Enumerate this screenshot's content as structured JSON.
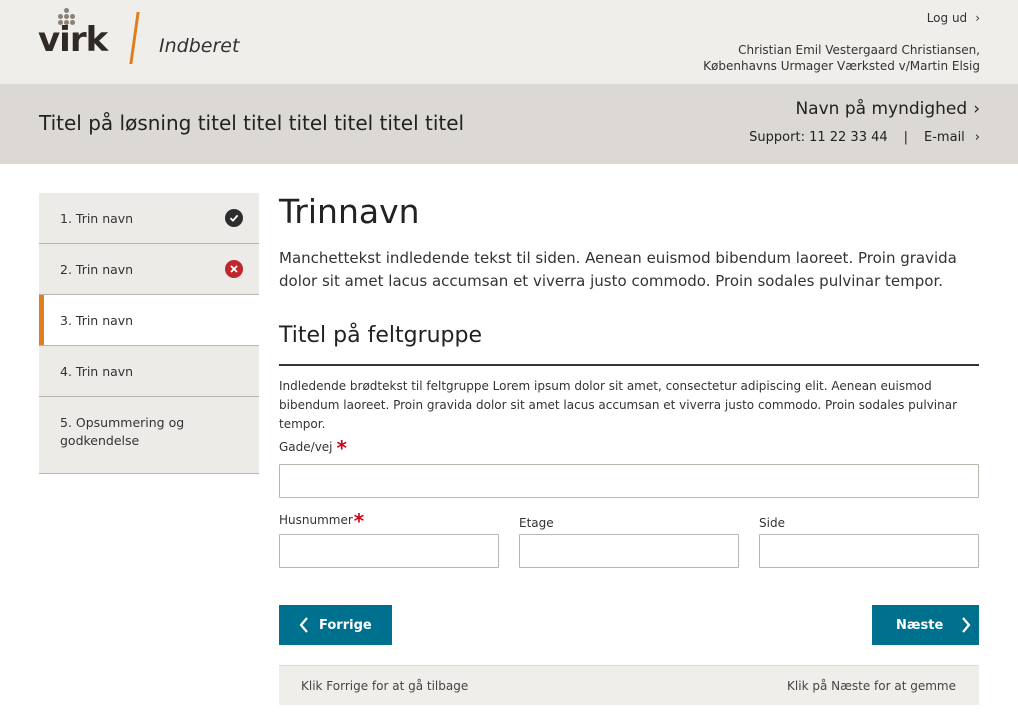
{
  "header": {
    "logo_text": "virk",
    "app_name": "Indberet",
    "logout_label": "Log ud",
    "user_name": "Christian Emil Vestergaard Christiansen,",
    "company": "Københavns Urmager Værksted v/Martin Elsig"
  },
  "titleband": {
    "solution_title": "Titel på løsning titel titel titel titel titel titel",
    "authority_label": "Navn på myndighed",
    "support_label": "Support: 11 22 33 44",
    "separator": "|",
    "email_label": "E-mail"
  },
  "steps": [
    {
      "label": "1. Trin navn",
      "status": "done"
    },
    {
      "label": "2. Trin navn",
      "status": "error"
    },
    {
      "label": "3. Trin navn",
      "status": "current"
    },
    {
      "label": "4. Trin navn",
      "status": ""
    },
    {
      "label": "5. Opsummering og godkendelse",
      "status": ""
    }
  ],
  "main": {
    "title": "Trinnavn",
    "lead": "Manchettekst indledende tekst til siden. Aenean euismod bibendum laoreet. Proin gravida dolor sit amet lacus accumsan et viverra justo commodo. Proin sodales pulvinar tempor.",
    "group_title": "Titel på feltgruppe",
    "group_intro": "Indledende brødtekst til feltgruppe Lorem ipsum dolor sit amet, consectetur adipiscing elit. Aenean euismod bibendum laoreet. Proin gravida dolor sit amet lacus accumsan et viverra justo commodo. Proin sodales pulvinar tempor.",
    "fields": {
      "street_label": "Gade/vej",
      "street_value": "",
      "house_label": "Husnummer",
      "house_value": "",
      "floor_label": "Etage",
      "floor_value": "",
      "side_label": "Side",
      "side_value": "",
      "required_mark": "*"
    }
  },
  "nav": {
    "prev_label": "Forrige",
    "next_label": "Næste",
    "prev_hint": "Klik Forrige for at gå tilbage",
    "next_hint": "Klik på Næste for at gemme"
  },
  "colors": {
    "accent_orange": "#e07e1f",
    "button_blue": "#00708f",
    "error_red": "#c0272d",
    "header_bg": "#f0eeea",
    "titleband_bg": "#dcd9d4"
  }
}
